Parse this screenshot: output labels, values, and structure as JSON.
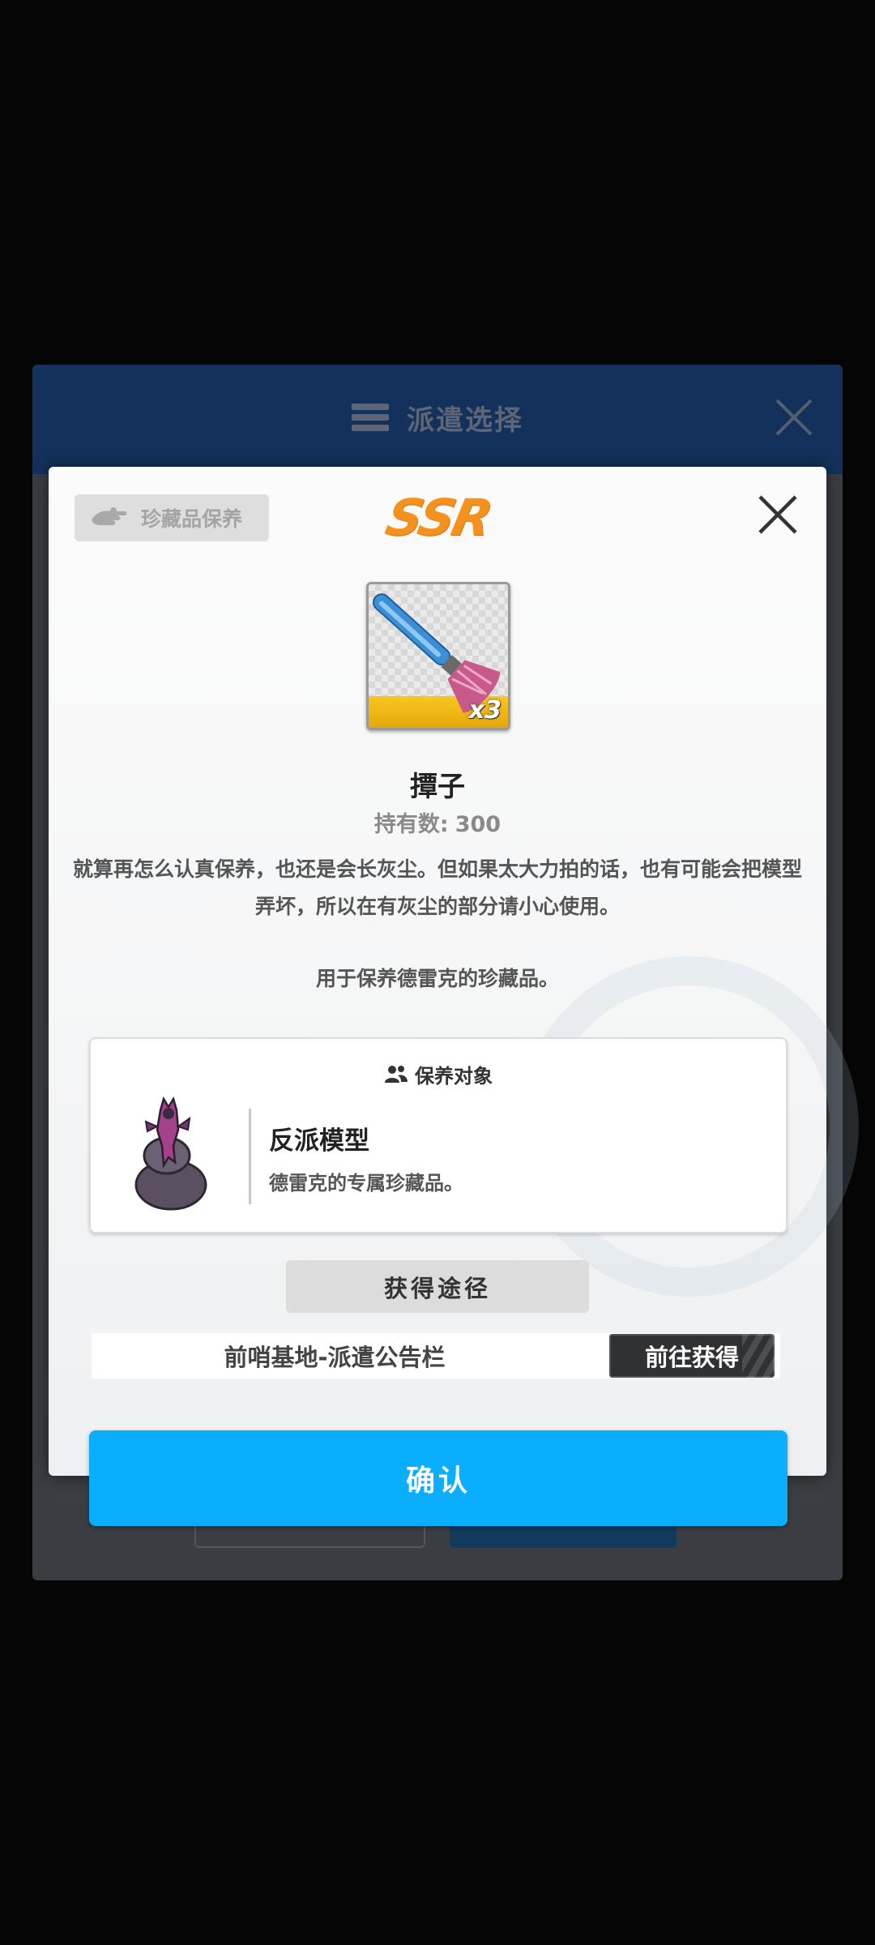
{
  "background_panel": {
    "title": "派遣选择",
    "title_icon": "list-icon",
    "close_icon": "close-icon"
  },
  "modal": {
    "tag": {
      "label": "珍藏品保养",
      "icon": "hand-icon"
    },
    "rarity": "SSR",
    "close_icon": "close-icon",
    "item": {
      "name": "撢子",
      "quantity_badge": "x3",
      "owned_label": "持有数:",
      "owned_count": "300",
      "description": "就算再怎么认真保养，也还是会长灰尘。但如果太大力拍的话，也有可能会把模型弄坏，所以在有灰尘的部分请小心使用。",
      "usage": "用于保养德雷克的珍藏品。",
      "icon": "duster-icon"
    },
    "target": {
      "header": "保养对象",
      "header_icon": "people-icon",
      "name": "反派模型",
      "description": "德雷克的专属珍藏品。"
    },
    "acquisition": {
      "header": "获得途径",
      "source": "前哨基地-派遣公告栏",
      "goto_label": "前往获得"
    },
    "confirm_label": "确认"
  },
  "colors": {
    "rarity": "#f5921e",
    "confirm": "#0aaeff",
    "goto_button": "#2f3133",
    "background_header": "#13315a"
  }
}
